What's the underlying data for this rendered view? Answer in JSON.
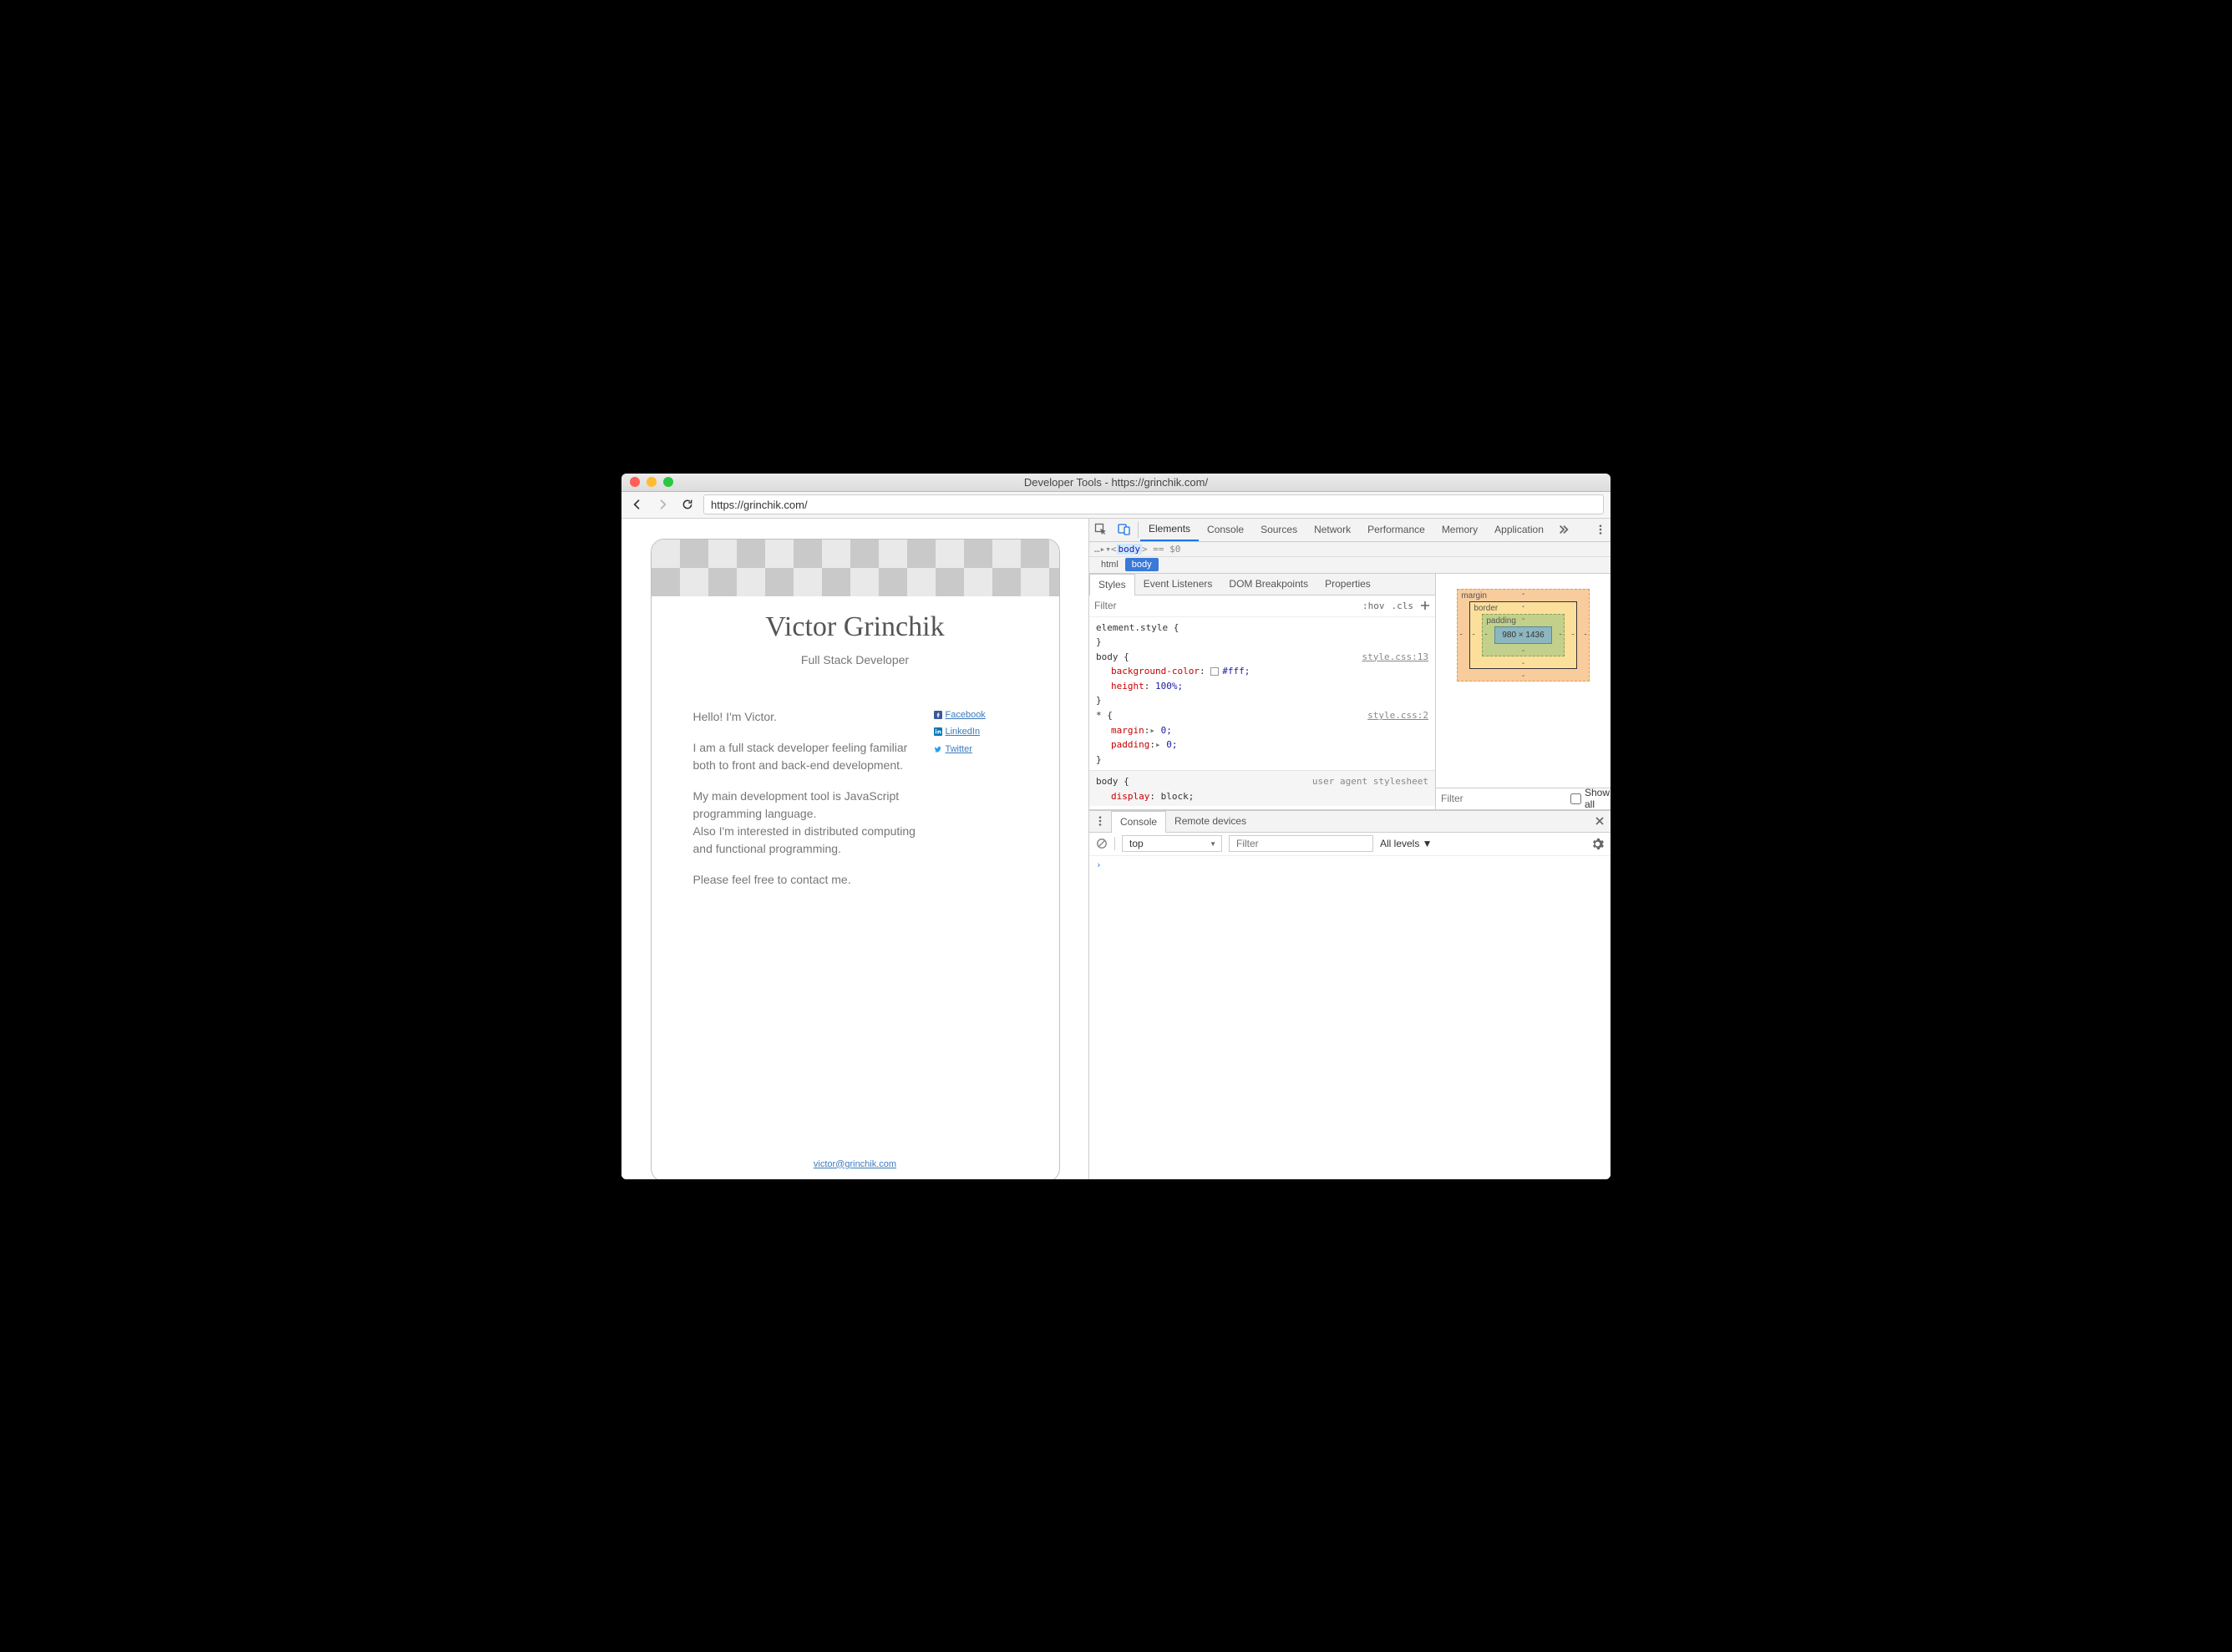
{
  "window": {
    "title": "Developer Tools - https://grinchik.com/"
  },
  "toolbar": {
    "url": "https://grinchik.com/"
  },
  "page": {
    "name": "Victor Grinchik",
    "subtitle": "Full Stack Developer",
    "paragraphs": {
      "p1": "Hello! I'm Victor.",
      "p2": "I am a full stack developer feeling familiar both to front and back-end development.",
      "p3a": "My main development tool is JavaScript programming language.",
      "p3b": "Also I'm interested in distributed computing and functional programming.",
      "p4": "Please feel free to contact me."
    },
    "social": {
      "facebook": "Facebook",
      "linkedin": "LinkedIn",
      "twitter": "Twitter"
    },
    "email": "victor@grinchik.com"
  },
  "devtools": {
    "tabs": {
      "elements": "Elements",
      "console": "Console",
      "sources": "Sources",
      "network": "Network",
      "performance": "Performance",
      "memory": "Memory",
      "application": "Application"
    },
    "dom_line_prefix": "…▸▾<",
    "dom_line_tag": "body",
    "dom_line_suffix": "> == $0",
    "breadcrumb": {
      "html": "html",
      "body": "body"
    },
    "styles": {
      "subtabs": {
        "styles": "Styles",
        "eventlisteners": "Event Listeners",
        "dombreakpoints": "DOM Breakpoints",
        "properties": "Properties"
      },
      "filter_placeholder": "Filter",
      "hov": ":hov",
      "cls": ".cls",
      "rules": {
        "r0_sel": "element.style {",
        "r0_close": "}",
        "r1_sel": "body {",
        "r1_src": "style.css:13",
        "r1_p1": "background-color",
        "r1_v1": "#fff;",
        "r1_p2": "height",
        "r1_v2": "100%;",
        "r1_close": "}",
        "r2_sel": "* {",
        "r2_src": "style.css:2",
        "r2_p1": "margin",
        "r2_v1": "0;",
        "r2_p2": "padding",
        "r2_v2": "0;",
        "r2_close": "}",
        "r3_sel": "body {",
        "r3_src": "user agent stylesheet",
        "r3_p1": "display",
        "r3_v1": "block;"
      }
    },
    "boxmodel": {
      "margin": "margin",
      "border": "border",
      "padding": "padding",
      "content": "980 × 1436",
      "dash": "-",
      "filter_placeholder": "Filter",
      "showall": "Show all"
    },
    "drawer": {
      "tabs": {
        "console": "Console",
        "remote": "Remote devices"
      },
      "context": "top",
      "filter_placeholder": "Filter",
      "levels": "All levels ▼",
      "prompt": "›"
    }
  }
}
